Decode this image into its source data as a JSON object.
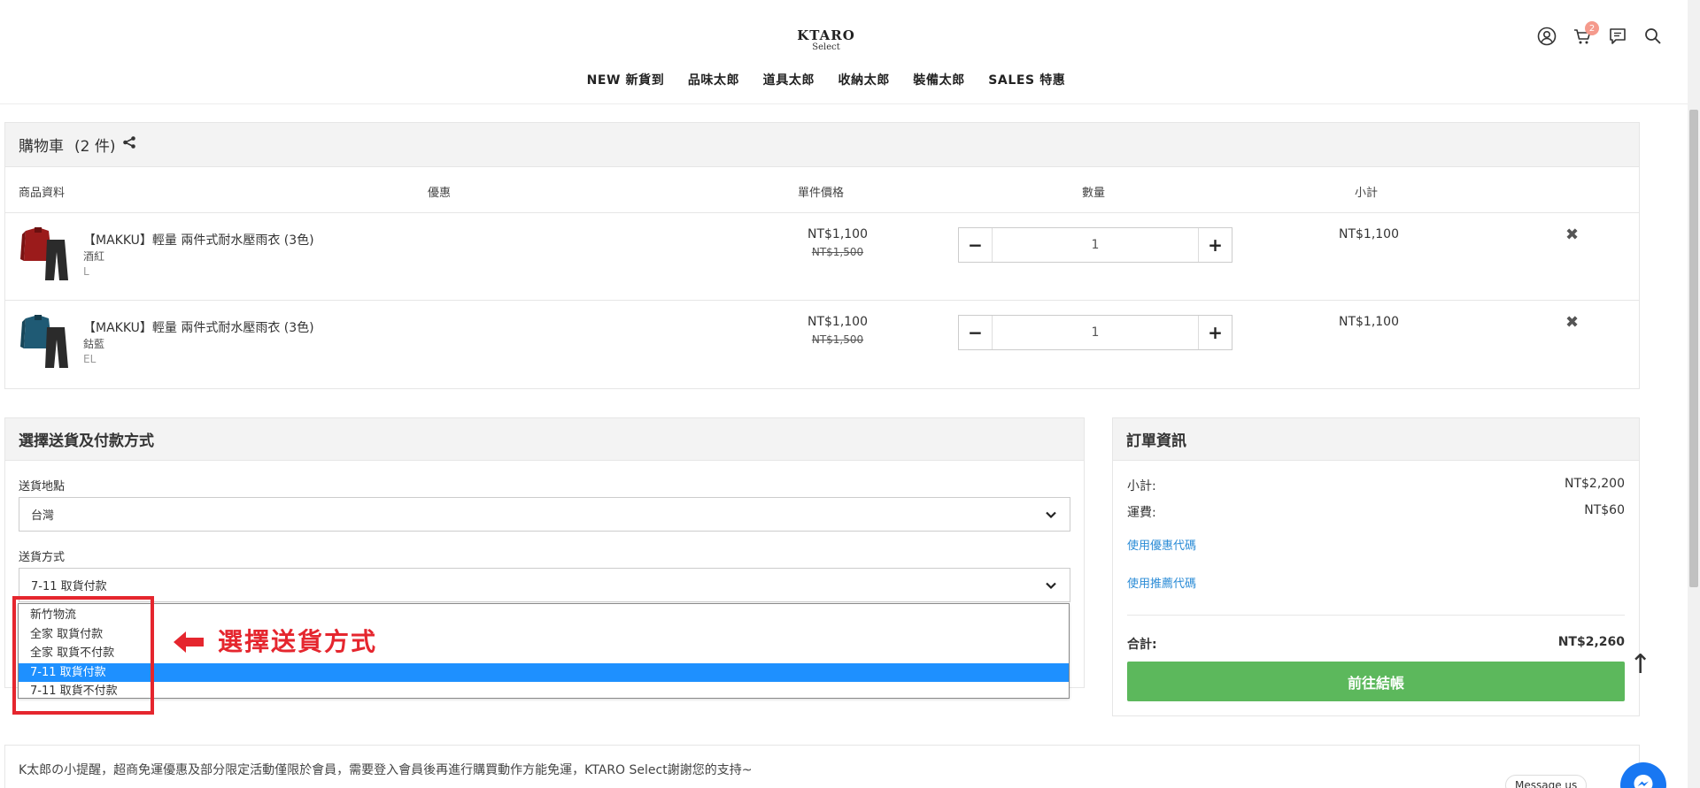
{
  "brand": {
    "name": "KTARO",
    "sub": "Select"
  },
  "nav": [
    "NEW 新貨到",
    "品味太郎",
    "道具太郎",
    "收納太郎",
    "裝備太郎",
    "SALES 特惠"
  ],
  "header_icons": [
    {
      "icon": "user-icon"
    },
    {
      "icon": "cart-icon",
      "badge": "2"
    },
    {
      "icon": "message-icon"
    },
    {
      "icon": "search-icon"
    }
  ],
  "cart": {
    "title": "購物車",
    "count_label": "(2 件)",
    "columns": {
      "product": "商品資料",
      "discount": "優惠",
      "unit_price": "單件價格",
      "quantity": "數量",
      "subtotal": "小計"
    },
    "items": [
      {
        "name": "【MAKKU】輕量 兩件式耐水壓雨衣 (3色)",
        "variant": "酒紅",
        "size": "L",
        "price": "NT$1,100",
        "original_price": "NT$1,500",
        "qty": "1",
        "subtotal": "NT$1,100",
        "color": "#8b1a1a"
      },
      {
        "name": "【MAKKU】輕量 兩件式耐水壓雨衣 (3色)",
        "variant": "鈷藍",
        "size": "EL",
        "price": "NT$1,100",
        "original_price": "NT$1,500",
        "qty": "1",
        "subtotal": "NT$1,100",
        "color": "#1f5f7a"
      }
    ]
  },
  "shipping": {
    "title": "選擇送貨及付款方式",
    "location_label": "送貨地點",
    "location_value": "台灣",
    "method_label": "送貨方式",
    "method_value": "7-11 取貨付款",
    "options": [
      "新竹物流",
      "全家 取貨付款",
      "全家 取貨不付款",
      "7-11 取貨付款",
      "7-11 取貨不付款"
    ],
    "selected_index": 3,
    "annotation": "選擇送貨方式"
  },
  "order": {
    "title": "訂單資訊",
    "subtotal_label": "小計:",
    "subtotal_value": "NT$2,200",
    "shipping_label": "運費:",
    "shipping_value": "NT$60",
    "coupon_link": "使用優惠代碼",
    "referral_link": "使用推薦代碼",
    "total_label": "合計:",
    "total_value": "NT$2,260",
    "checkout_label": "前往結帳"
  },
  "notice": "K太郎の小提醒，超商免運優惠及部分限定活動僅限於會員，需要登入會員後再進行購買動作方能免運，KTARO Select謝謝您的支持~",
  "messenger_label": "Message us",
  "colors": {
    "accent_green": "#5cb85c",
    "link_blue": "#2a8bd6",
    "highlight_red": "#e5262e",
    "selected_blue": "#1e90ff"
  }
}
